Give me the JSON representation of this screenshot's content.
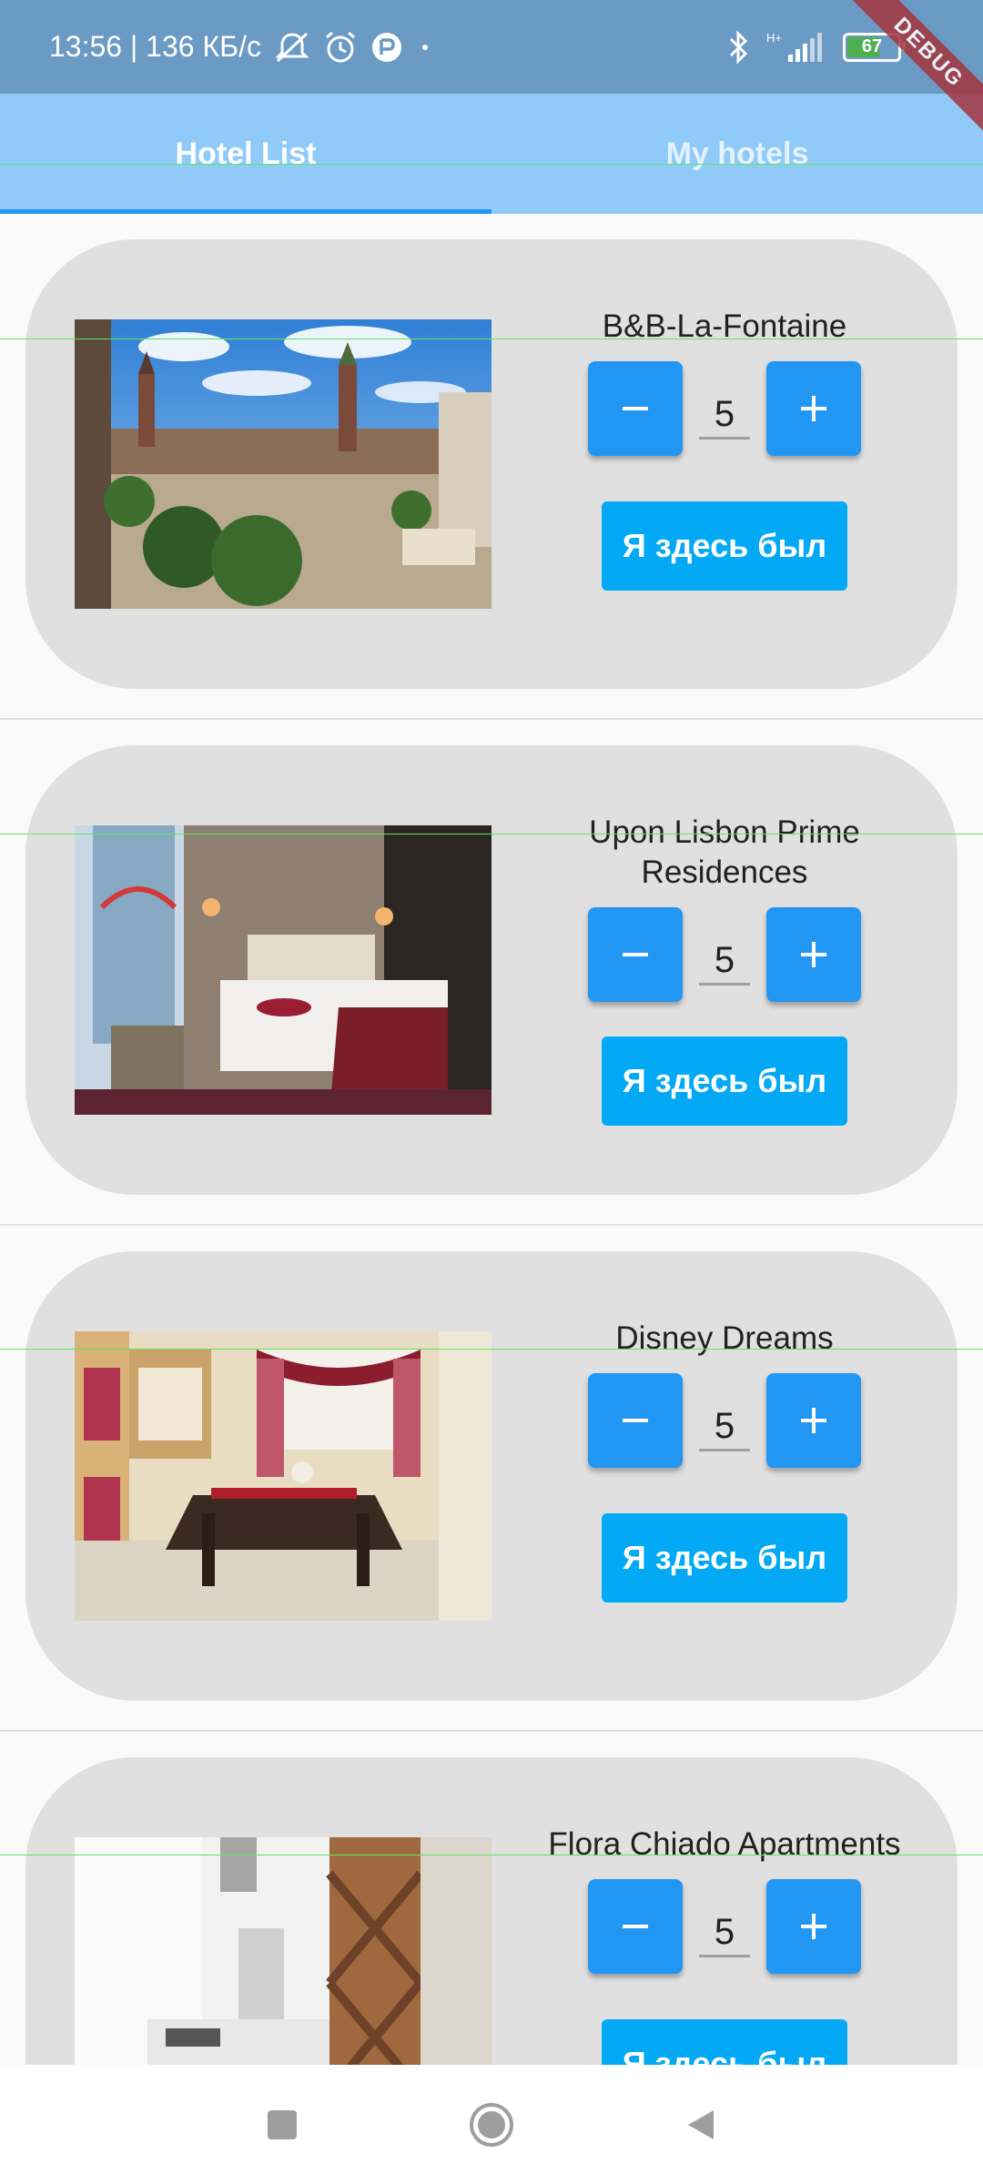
{
  "status_bar": {
    "time_speed": "13:56 | 136 КБ/с",
    "network_label": "H+",
    "battery_level": "67"
  },
  "debug_banner": "DEBUG",
  "tabs": [
    {
      "label": "Hotel List",
      "selected": true
    },
    {
      "label": "My hotels",
      "selected": false
    }
  ],
  "hotels": [
    {
      "name": "B&B-La-Fontaine",
      "count": "5",
      "visited_label": "Я здесь был"
    },
    {
      "name": "Upon Lisbon Prime Residences",
      "count": "5",
      "visited_label": "Я здесь был"
    },
    {
      "name": "Disney Dreams",
      "count": "5",
      "visited_label": "Я здесь был"
    },
    {
      "name": "Flora Chiado Apartments",
      "count": "5",
      "visited_label": "Я здесь был"
    }
  ],
  "colors": {
    "status_bar": "#6b9ac4",
    "tab_bar": "#90caf9",
    "accent": "#2196f3",
    "visited_button": "#03a9f4",
    "card": "#e0e0e0"
  }
}
